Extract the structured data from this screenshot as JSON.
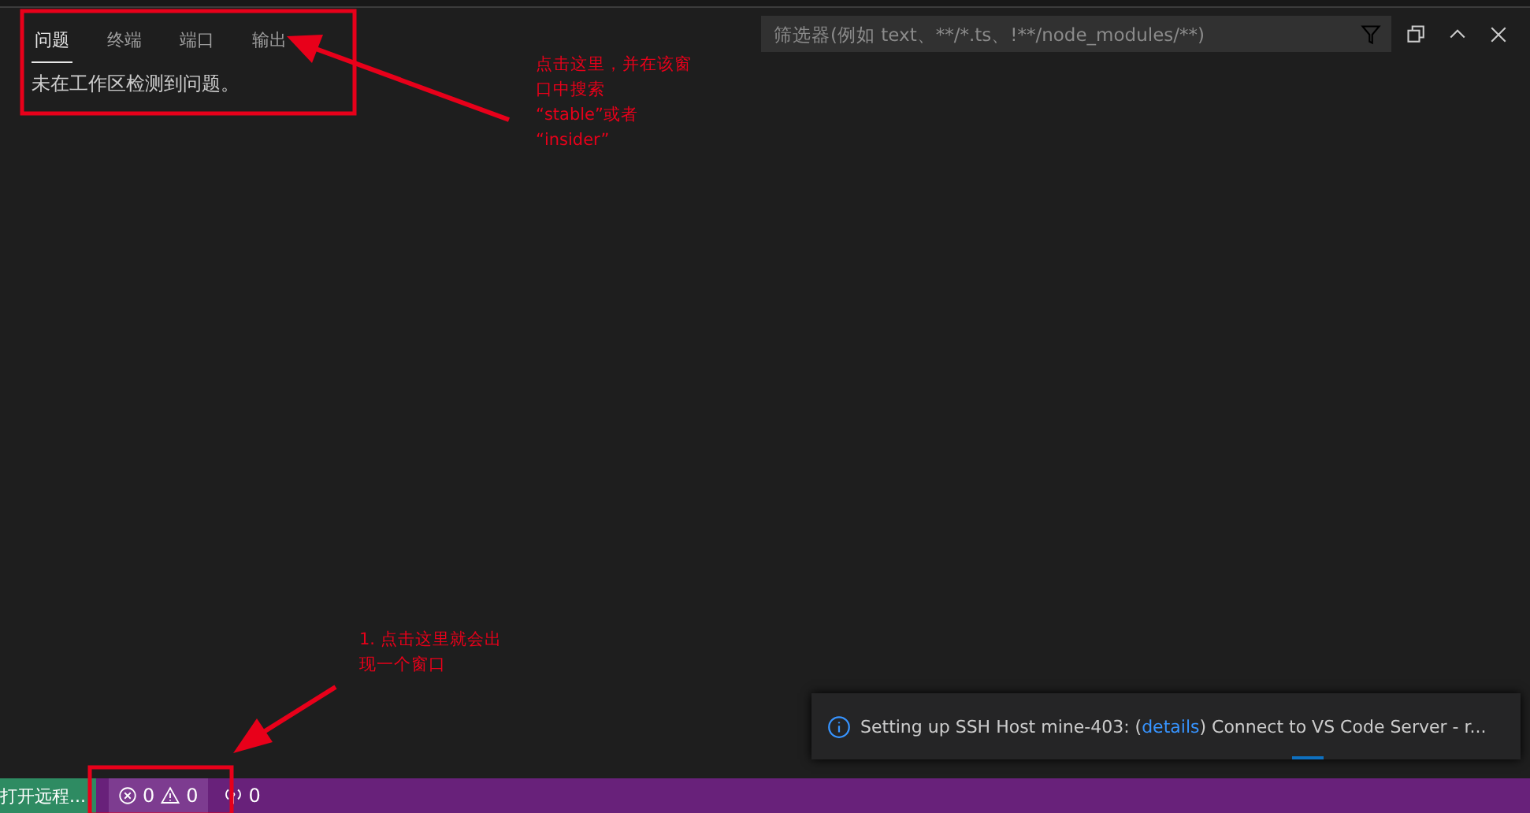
{
  "panel": {
    "tabs": [
      {
        "label": "问题",
        "selected": true
      },
      {
        "label": "终端",
        "selected": false
      },
      {
        "label": "端口",
        "selected": false
      },
      {
        "label": "输出",
        "selected": false
      }
    ],
    "filter": {
      "placeholder": "筛选器(例如 text、**/*.ts、!**/node_modules/**)"
    },
    "message": "未在工作区检测到问题。"
  },
  "notification": {
    "text_before": "Setting up SSH Host mine-403: (",
    "link": "details",
    "text_after": ") Connect to VS Code Server - r..."
  },
  "status_bar": {
    "remote": "打开远程...",
    "errors": "0",
    "warnings": "0",
    "ports": "0"
  },
  "annotations": [
    {
      "text": "点击这里，并在该窗口中搜索 “stable”或者 “insider”"
    },
    {
      "text": "1. 点击这里就会出现一个窗口"
    }
  ]
}
